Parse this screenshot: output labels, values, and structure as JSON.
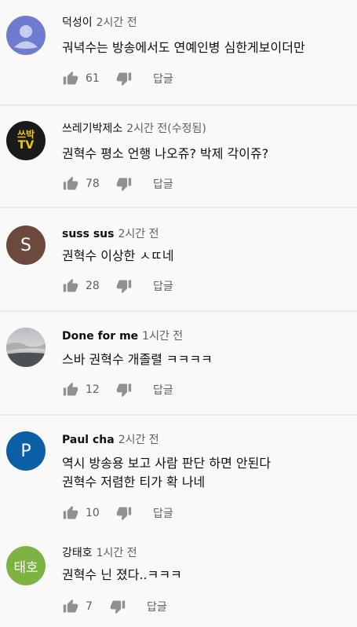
{
  "comments": [
    {
      "author": "덕성이",
      "time": "2시간 전",
      "lines": [
        "궈녁수는 방송에서도 연예인병 심한게보이더만"
      ],
      "likes": "61",
      "reply": "답글",
      "avatar": {
        "type": "default",
        "color": "#6e7ccf"
      }
    },
    {
      "author": "쓰레기박제소",
      "time": "2시간 전(수정됨)",
      "lines": [
        "권혁수 평소 언행 나오쥬? 박제 각이쥬?"
      ],
      "likes": "78",
      "reply": "답글",
      "avatar": {
        "type": "logo",
        "line1": "쓰박",
        "line2": "TV",
        "color": "#1a1a1a",
        "accent": "#f5c518"
      }
    },
    {
      "author": "suss sus",
      "time": "2시간 전",
      "lines": [
        "권혁수 이상한 ㅅㄸ네"
      ],
      "likes": "28",
      "reply": "답글",
      "avatar": {
        "type": "letter",
        "letter": "S",
        "color": "#6b4a3d"
      }
    },
    {
      "author": "Done for me",
      "time": "1시간 전",
      "lines": [
        "스바 권혁수 개졸렬 ㅋㅋㅋㅋ"
      ],
      "likes": "12",
      "reply": "답글",
      "avatar": {
        "type": "photo",
        "color": "#8a8f99"
      }
    },
    {
      "author": "Paul cha",
      "time": "2시간 전",
      "lines": [
        "역시 방송용 보고 사람 판단 하면 안된다",
        "권혁수 저렴한 티가 확 나네"
      ],
      "likes": "10",
      "reply": "답글",
      "avatar": {
        "type": "letter",
        "letter": "P",
        "color": "#0b5fa5"
      }
    },
    {
      "author": "강태호",
      "time": "1시간 전",
      "lines": [
        "권혁수 닌 졌다..ㅋㅋㅋ"
      ],
      "likes": "7",
      "reply": "답글",
      "avatar": {
        "type": "letter",
        "letter": "태호",
        "color": "#7cb342"
      }
    }
  ],
  "icons": {
    "like": "thumbs-up-icon",
    "dislike": "thumbs-down-icon"
  }
}
